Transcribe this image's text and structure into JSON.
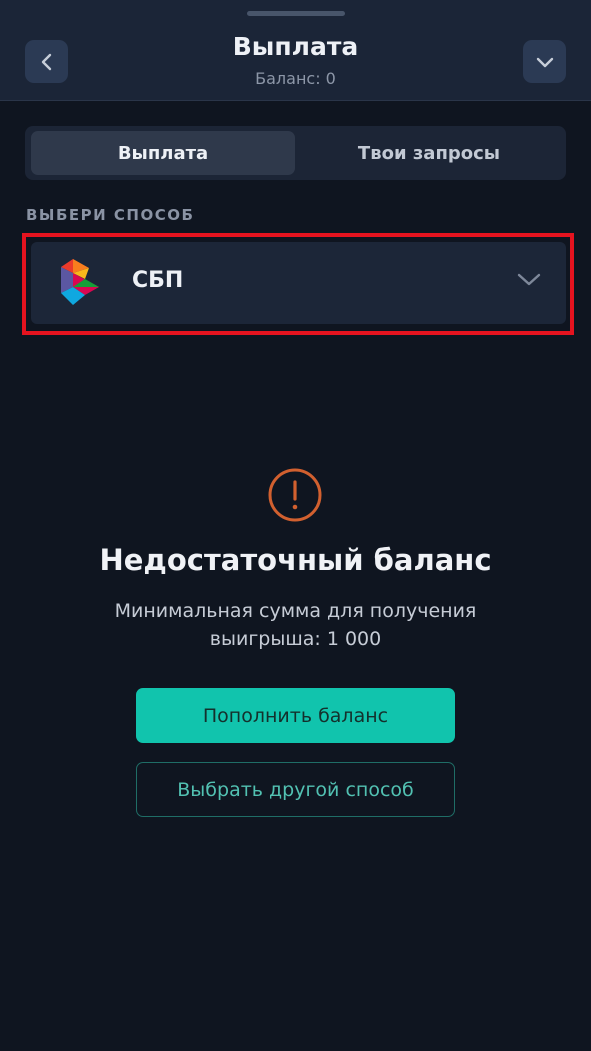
{
  "header": {
    "title": "Выплата",
    "balance_text": "Баланс: 0",
    "back_icon": "chevron-left-icon",
    "collapse_icon": "chevron-down-icon"
  },
  "tabs": [
    {
      "label": "Выплата",
      "active": true
    },
    {
      "label": "Твои запросы",
      "active": false
    }
  ],
  "method_section": {
    "label": "ВЫБЕРИ СПОСОБ",
    "selected": {
      "name": "СБП",
      "icon": "sbp-logo-icon",
      "chevron": "chevron-down-icon"
    }
  },
  "warning": {
    "icon": "exclamation-circle-icon",
    "title": "Недостаточный баланс",
    "message": "Минимальная сумма для получения выигрыша: 1 000"
  },
  "actions": {
    "primary_label": "Пополнить баланс",
    "secondary_label": "Выбрать другой способ"
  },
  "colors": {
    "background": "#0f1520",
    "accent": "#11c4ad",
    "warning": "#d2602f",
    "highlight": "#e5131f"
  }
}
